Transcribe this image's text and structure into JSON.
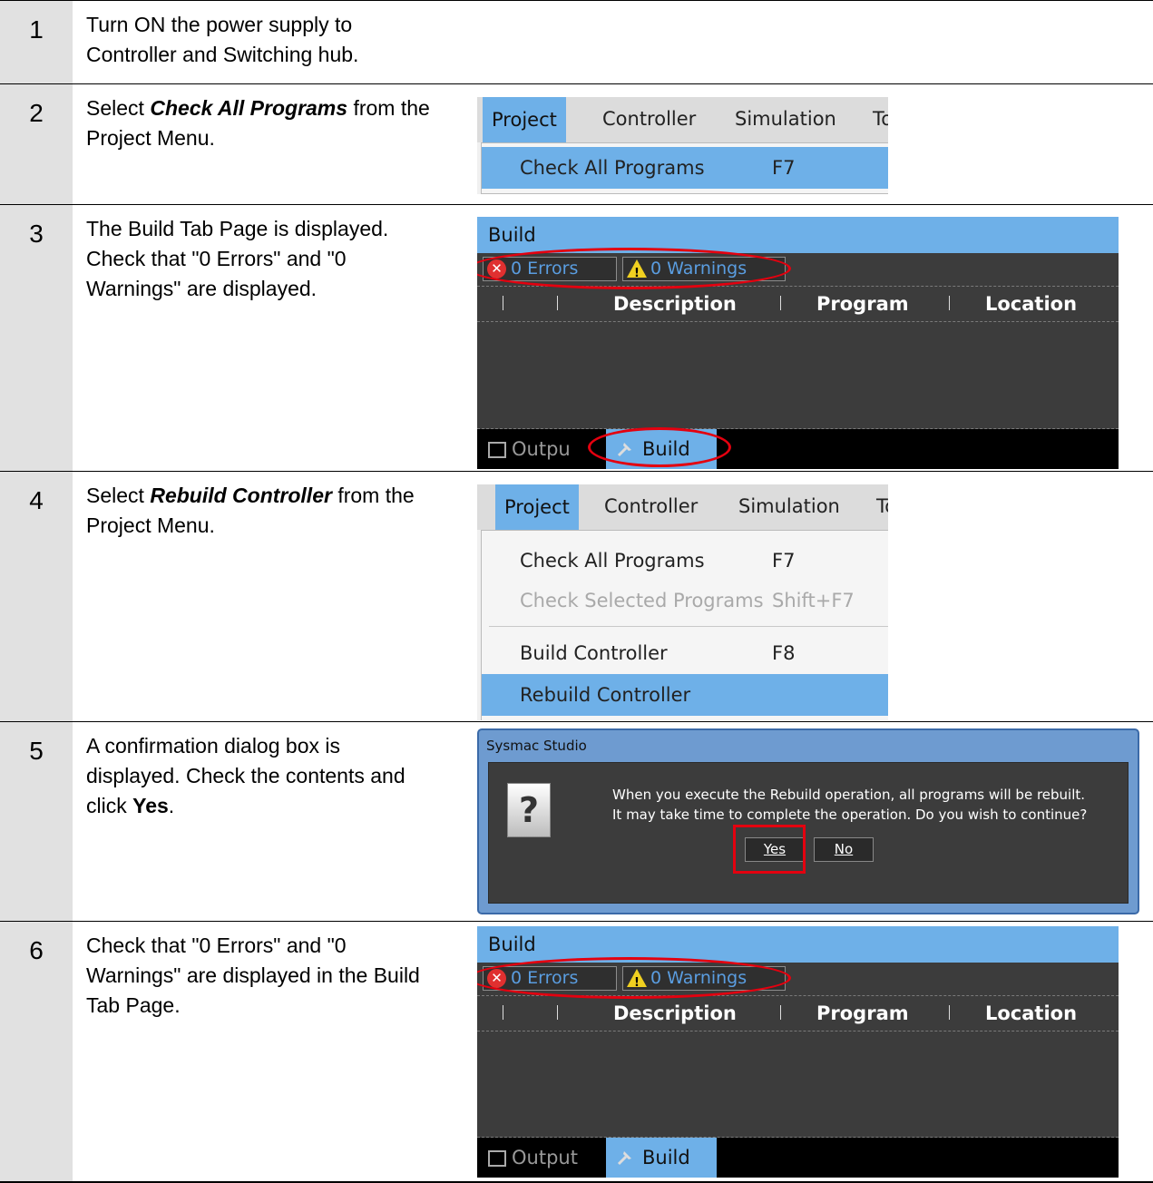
{
  "steps": [
    {
      "num": "1",
      "text": "Turn ON the power supply to Controller and Switching hub."
    },
    {
      "num": "2",
      "pre": "Select ",
      "strong": "Check All Programs",
      "post": " from the Project Menu."
    },
    {
      "num": "3",
      "text": "The Build Tab Page is displayed. Check that \"0 Errors\" and \"0 Warnings\" are displayed."
    },
    {
      "num": "4",
      "pre": "Select ",
      "strong": "Rebuild Controller",
      "post": " from the Project Menu."
    },
    {
      "num": "5",
      "pre": "A confirmation dialog box is displayed. Check the contents and click ",
      "strong": "Yes",
      "post": "."
    },
    {
      "num": "6",
      "text": "Check that \"0 Errors\" and \"0 Warnings\" are displayed in the Build Tab Page."
    }
  ],
  "menu": {
    "items": [
      "Project",
      "Controller",
      "Simulation",
      "Too"
    ],
    "check_all": "Check All Programs",
    "check_all_key": "F7",
    "check_selected": "Check Selected Programs",
    "check_selected_key": "Shift+F7",
    "build": "Build Controller",
    "build_key": "F8",
    "rebuild": "Rebuild Controller"
  },
  "build_panel": {
    "title": "Build",
    "errors": "0  Errors",
    "warnings": "0  Warnings",
    "col_description": "Description",
    "col_program": "Program",
    "col_location": "Location",
    "tab_output": "Output",
    "tab_output_cut": "Outpu",
    "tab_build": "Build"
  },
  "dialog": {
    "title": "Sysmac Studio",
    "icon_glyph": "?",
    "line1": "When you execute the Rebuild operation, all programs will be rebuilt.",
    "line2": "It may take time to complete the operation. Do you wish to continue?",
    "yes": "Yes",
    "no": "No"
  }
}
